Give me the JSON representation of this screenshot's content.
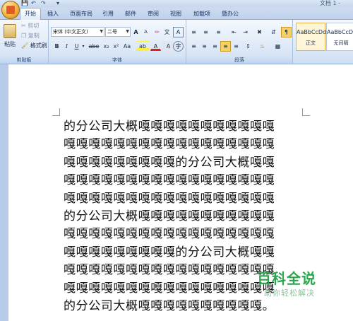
{
  "title_bar": {
    "doc_title": "文档 1 -",
    "quick_access": [
      "save-icon",
      "undo-icon",
      "redo-icon",
      "customize-icon"
    ]
  },
  "tabs": [
    {
      "label": "开始",
      "active": true
    },
    {
      "label": "插入"
    },
    {
      "label": "页面布局"
    },
    {
      "label": "引用"
    },
    {
      "label": "邮件"
    },
    {
      "label": "审阅"
    },
    {
      "label": "视图"
    },
    {
      "label": "加载项"
    },
    {
      "label": "暨办公"
    }
  ],
  "clipboard": {
    "paste_label": "粘贴",
    "cut_label": "剪切",
    "copy_label": "复制",
    "format_painter_label": "格式刷",
    "group_label": "剪贴板"
  },
  "font": {
    "font_name": "宋体 (中文正文)",
    "font_size": "二号",
    "grow_label": "A",
    "shrink_label": "A",
    "bold": "B",
    "italic": "I",
    "underline": "U",
    "strike": "abe",
    "subscript": "x₂",
    "superscript": "x²",
    "change_case": "Aa",
    "highlight": "ab",
    "font_color": "A",
    "group_label": "字体"
  },
  "paragraph": {
    "group_label": "段落"
  },
  "styles": {
    "items": [
      {
        "sample": "AaBbCcDd",
        "name": "正文"
      },
      {
        "sample": "AaBbCcDc",
        "name": "无间隔"
      }
    ]
  },
  "document": {
    "lines": [
      "的分公司大概嘎嘎嘎嘎嘎嘎嘎嘎嘎嘎嘎",
      "嘎嘎嘎嘎嘎嘎嘎嘎嘎嘎嘎嘎嘎嘎嘎嘎嘎",
      "嘎嘎嘎嘎嘎嘎嘎嘎嘎的分公司大概嘎嘎",
      "嘎嘎嘎嘎嘎嘎嘎嘎嘎嘎嘎嘎嘎嘎嘎嘎嘎",
      "嘎嘎嘎嘎嘎嘎嘎嘎嘎嘎嘎嘎嘎嘎嘎嘎嘎",
      "的分公司大概嘎嘎嘎嘎嘎嘎嘎嘎嘎嘎嘎",
      "嘎嘎嘎嘎嘎嘎嘎嘎嘎嘎嘎嘎嘎嘎嘎嘎嘎",
      "嘎嘎嘎嘎嘎嘎嘎嘎嘎的分公司大概嘎嘎",
      "嘎嘎嘎嘎嘎嘎嘎嘎嘎嘎嘎嘎嘎嘎嘎嘎嘎",
      "嘎嘎嘎嘎嘎嘎嘎嘎嘎嘎嘎嘎嘎嘎嘎嘎嘎",
      "的分公司大概嘎嘎嘎嘎嘎嘎嘎嘎嘎嘎。"
    ]
  },
  "watermark": {
    "logo": "百科全说",
    "subtitle": "助你轻松解决"
  }
}
